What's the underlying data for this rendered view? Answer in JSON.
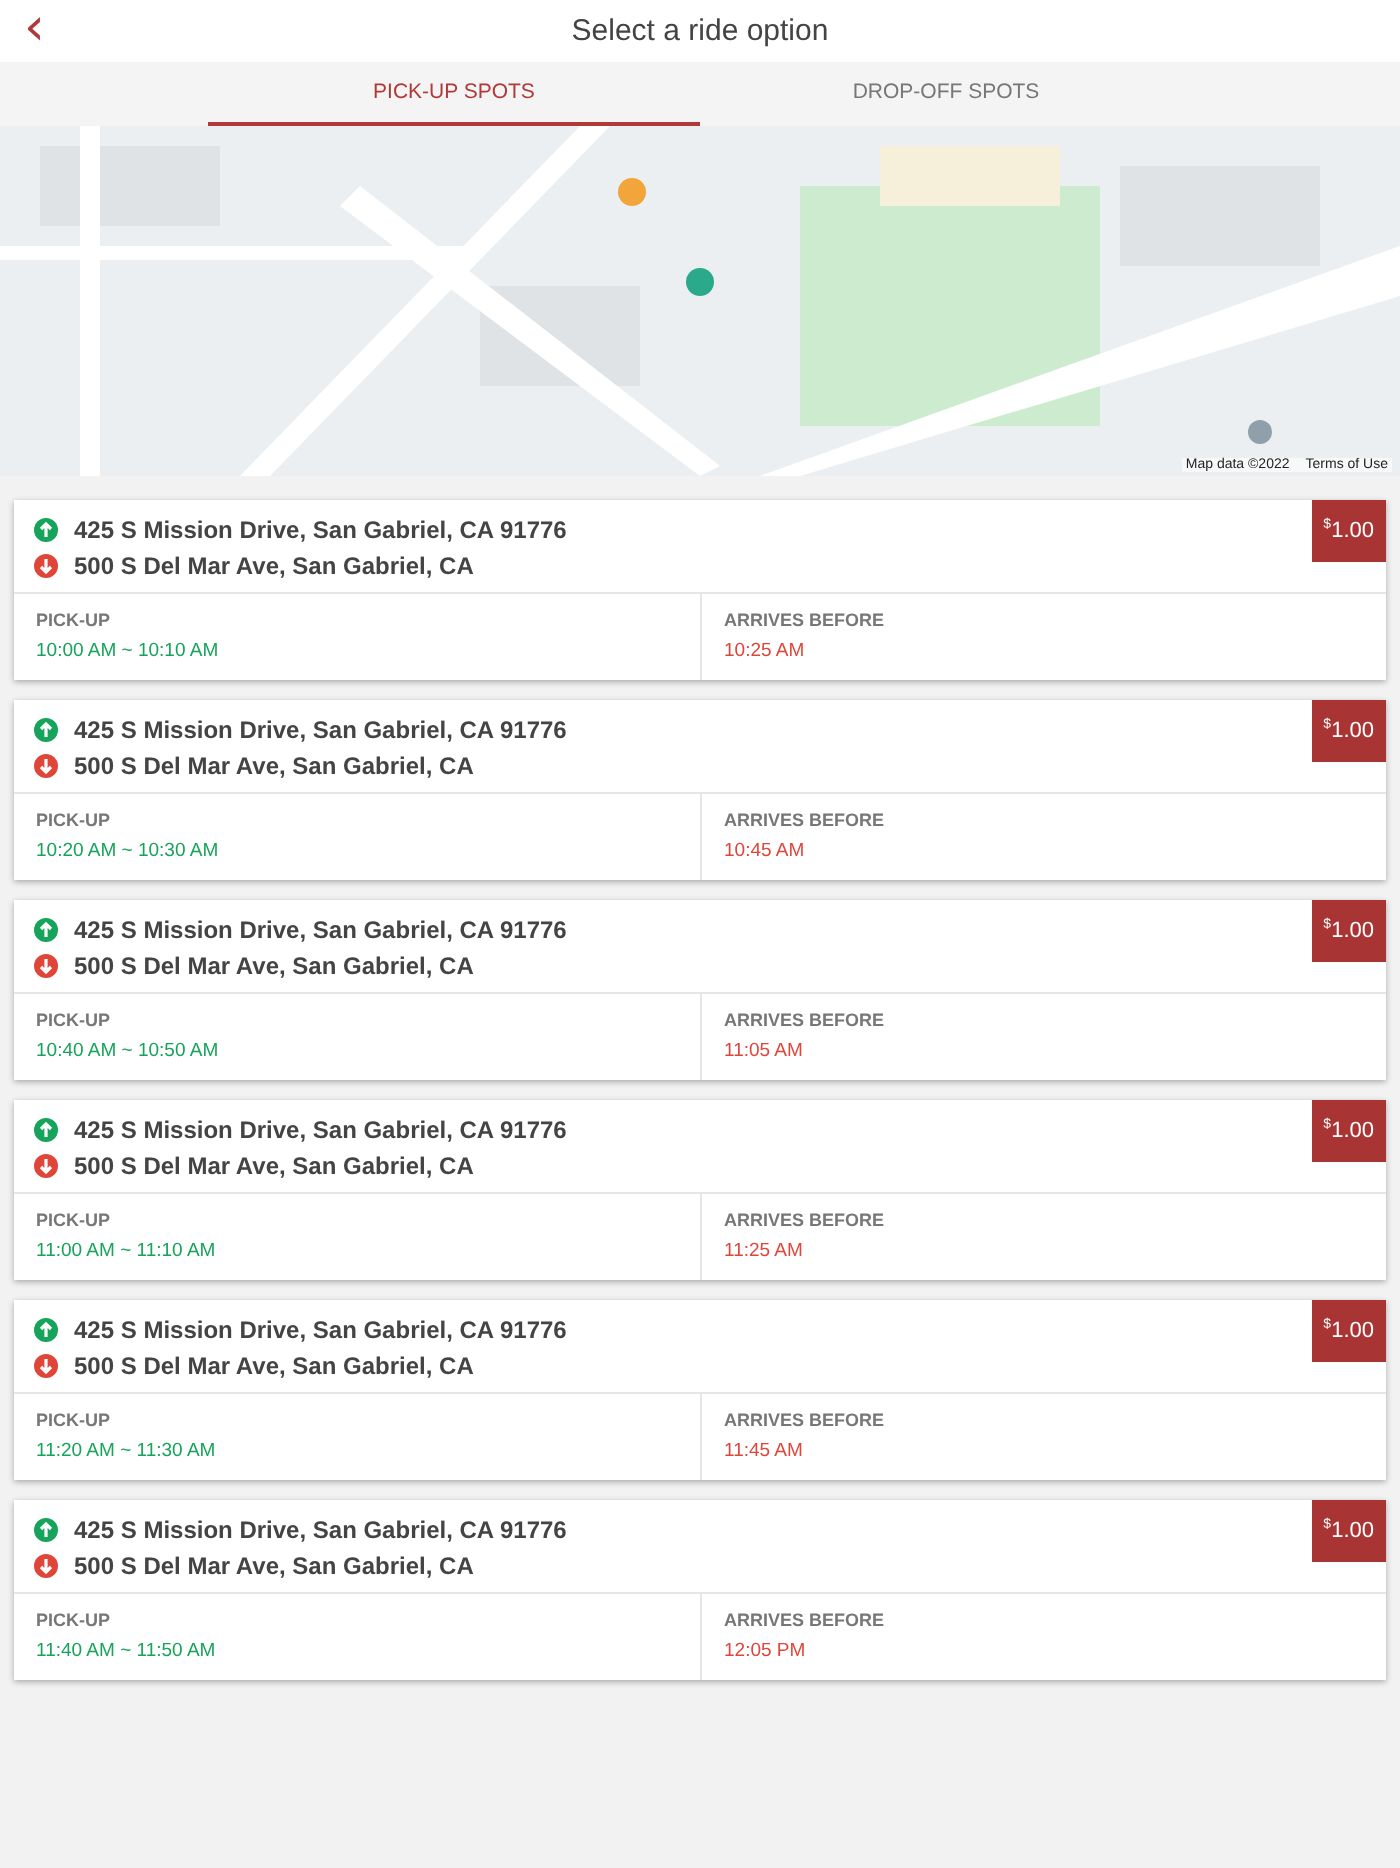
{
  "header": {
    "back_icon": "‹",
    "title": "Select a ride option"
  },
  "tabs": [
    {
      "label": "PICK-UP SPOTS",
      "selected": true
    },
    {
      "label": "DROP-OFF SPOTS",
      "selected": false
    }
  ],
  "map": {
    "attribution": "Map data ©2022",
    "terms_link": "Terms of Use"
  },
  "rides": [
    {
      "pickup_address": "425 S Mission Drive, San Gabriel, CA 91776",
      "dropoff_address": "500 S Del Mar Ave, San Gabriel, CA",
      "currency": "$",
      "price": "1.00",
      "pickup_label": "PICK-UP",
      "pickup_window": "10:00 AM ~ 10:10 AM",
      "arrival_label": "ARRIVES BEFORE",
      "arrival_time": "10:25 AM"
    },
    {
      "pickup_address": "425 S Mission Drive, San Gabriel, CA 91776",
      "dropoff_address": "500 S Del Mar Ave, San Gabriel, CA",
      "currency": "$",
      "price": "1.00",
      "pickup_label": "PICK-UP",
      "pickup_window": "10:20 AM ~ 10:30 AM",
      "arrival_label": "ARRIVES BEFORE",
      "arrival_time": "10:45 AM"
    },
    {
      "pickup_address": "425 S Mission Drive, San Gabriel, CA 91776",
      "dropoff_address": "500 S Del Mar Ave, San Gabriel, CA",
      "currency": "$",
      "price": "1.00",
      "pickup_label": "PICK-UP",
      "pickup_window": "10:40 AM ~ 10:50 AM",
      "arrival_label": "ARRIVES BEFORE",
      "arrival_time": "11:05 AM"
    },
    {
      "pickup_address": "425 S Mission Drive, San Gabriel, CA 91776",
      "dropoff_address": "500 S Del Mar Ave, San Gabriel, CA",
      "currency": "$",
      "price": "1.00",
      "pickup_label": "PICK-UP",
      "pickup_window": "11:00 AM ~ 11:10 AM",
      "arrival_label": "ARRIVES BEFORE",
      "arrival_time": "11:25 AM"
    },
    {
      "pickup_address": "425 S Mission Drive, San Gabriel, CA 91776",
      "dropoff_address": "500 S Del Mar Ave, San Gabriel, CA",
      "currency": "$",
      "price": "1.00",
      "pickup_label": "PICK-UP",
      "pickup_window": "11:20 AM ~ 11:30 AM",
      "arrival_label": "ARRIVES BEFORE",
      "arrival_time": "11:45 AM"
    },
    {
      "pickup_address": "425 S Mission Drive, San Gabriel, CA 91776",
      "dropoff_address": "500 S Del Mar Ave, San Gabriel, CA",
      "currency": "$",
      "price": "1.00",
      "pickup_label": "PICK-UP",
      "pickup_window": "11:40 AM ~ 11:50 AM",
      "arrival_label": "ARRIVES BEFORE",
      "arrival_time": "12:05 PM"
    }
  ]
}
